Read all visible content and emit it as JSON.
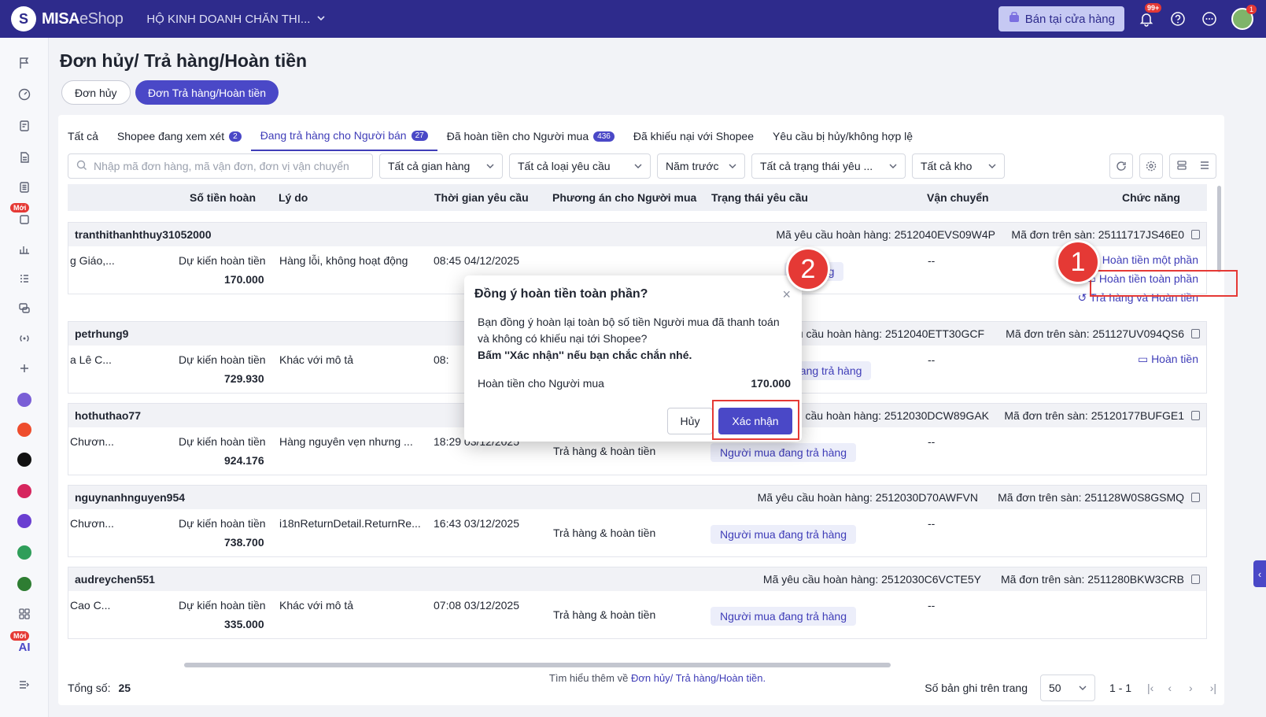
{
  "header": {
    "logo_mark": "S",
    "logo_strong": "MISA",
    "logo_light": "eShop",
    "shop_name": "HỘ KINH DOANH CHĂN THI...",
    "store_button": "Bán tại cửa hàng",
    "notif_badge": "99+",
    "avatar_badge": "1"
  },
  "sidebar": {
    "new_badge_1": "Mới",
    "new_badge_2": "Mới",
    "ai_label": "AI"
  },
  "page": {
    "title": "Đơn hủy/ Trả hàng/Hoàn tiền",
    "seg_cancel": "Đơn hủy",
    "seg_return": "Đơn Trả hàng/Hoàn tiền"
  },
  "tabs": [
    {
      "label": "Tất cả",
      "count": ""
    },
    {
      "label": "Shopee đang xem xét",
      "count": "2"
    },
    {
      "label": "Đang trả hàng cho Người bán",
      "count": "27"
    },
    {
      "label": "Đã hoàn tiền cho Người mua",
      "count": "436"
    },
    {
      "label": "Đã khiếu nại với Shopee",
      "count": ""
    },
    {
      "label": "Yêu cầu bị hủy/không hợp lệ",
      "count": ""
    }
  ],
  "filters": {
    "search_placeholder": "Nhập mã đơn hàng, mã vận đơn, đơn vị vận chuyển",
    "stall": "Tất cả gian hàng",
    "request_type": "Tất cả loại yêu cầu",
    "period": "Năm trước",
    "status": "Tất cả trạng thái yêu ...",
    "warehouse": "Tất cả kho"
  },
  "columns": {
    "refund_amount": "Số tiền hoàn",
    "reason": "Lý do",
    "request_time": "Thời gian yêu cầu",
    "buyer_option": "Phương án cho Người mua",
    "request_status": "Trạng thái yêu cầu",
    "shipping": "Vận chuyển",
    "actions": "Chức năng"
  },
  "labels": {
    "expected_refund": "Dự kiến hoàn tiền",
    "req_prefix": "Mã yêu cầu hoàn hàng: ",
    "order_prefix": "Mã đơn trên sàn: "
  },
  "rows": [
    {
      "user": "tranthithanhthuy31052000",
      "req": "Mã yêu cầu hoàn hàng: 2512040EVS09W4P",
      "order": "Mã đơn trên sàn: 25111717JS46E0",
      "product": "g Giáo,...",
      "amount": "170.000",
      "reason": "Hàng lỗi, không hoạt động",
      "time": "08:45 04/12/2025",
      "option": "",
      "status": "trả hàng",
      "shipping": "--"
    },
    {
      "user": "petrhung9",
      "req": "yêu cầu hoàn hàng: 2512040ETT30GCF",
      "order": "Mã đơn trên sàn: 251127UV094QS6",
      "product": "a Lê C...",
      "amount": "729.930",
      "reason": "Khác với mô tả",
      "time": "08:",
      "option": "",
      "status": "đang trả hàng",
      "shipping": "--"
    },
    {
      "user": "hothuthao77",
      "req": "yêu cầu hoàn hàng: 2512030DCW89GAK",
      "order": "Mã đơn trên sàn: 25120177BUFGE1",
      "product": "Chươn...",
      "amount": "924.176",
      "reason": "Hàng nguyên vẹn nhưng ...",
      "time": "18:29 03/12/2025",
      "option": "Trả hàng & hoàn tiền",
      "status": "Người mua đang trả hàng",
      "shipping": "--"
    },
    {
      "user": "nguynanhnguyen954",
      "req": "Mã yêu cầu hoàn hàng: 2512030D70AWFVN",
      "order": "Mã đơn trên sàn: 251128W0S8GSMQ",
      "product": "Chươn...",
      "amount": "738.700",
      "reason": "i18nReturnDetail.ReturnRe...",
      "time": "16:43 03/12/2025",
      "option": "Trả hàng & hoàn tiền",
      "status": "Người mua đang trả hàng",
      "shipping": "--"
    },
    {
      "user": "audreychen551",
      "req": "Mã yêu cầu hoàn hàng: 2512030C6VCTE5Y",
      "order": "Mã đơn trên sàn: 2511280BKW3CRB",
      "product": "Cao C...",
      "amount": "335.000",
      "reason": "Khác với mô tả",
      "time": "07:08 03/12/2025",
      "option": "Trả hàng & hoàn tiền",
      "status": "Người mua đang trả hàng",
      "shipping": "--"
    }
  ],
  "row_actions": {
    "partial_refund": "Hoàn tiền một phần",
    "full_refund": "Hoàn tiền toàn phần",
    "return_refund": "Trả hàng và Hoàn tiền",
    "refund": "Hoàn tiền"
  },
  "footer": {
    "total_label": "Tổng số:",
    "total_value": "25",
    "per_page_label": "Số bản ghi trên trang",
    "per_page_value": "50",
    "range": "1 - 1"
  },
  "learn_more": {
    "prefix": "Tìm hiểu thêm về ",
    "link": "Đơn hủy/ Trả hàng/Hoàn tiền."
  },
  "modal": {
    "title": "Đồng ý hoàn tiền toàn phần?",
    "body": "Bạn đồng ý hoàn lại toàn bộ số tiền Người mua đã thanh toán và không có khiếu nại tới Shopee?",
    "emphasis": "Bấm ''Xác nhận'' nếu bạn chắc chắn nhé.",
    "refund_label": "Hoàn tiền cho Người mua",
    "refund_value": "170.000",
    "cancel": "Hủy",
    "confirm": "Xác nhận"
  },
  "annotations": {
    "marker_1": "1",
    "marker_2": "2"
  },
  "colors": {
    "primary": "#4a48c7",
    "topbar": "#2e2b8c",
    "highlight": "#e53935"
  }
}
